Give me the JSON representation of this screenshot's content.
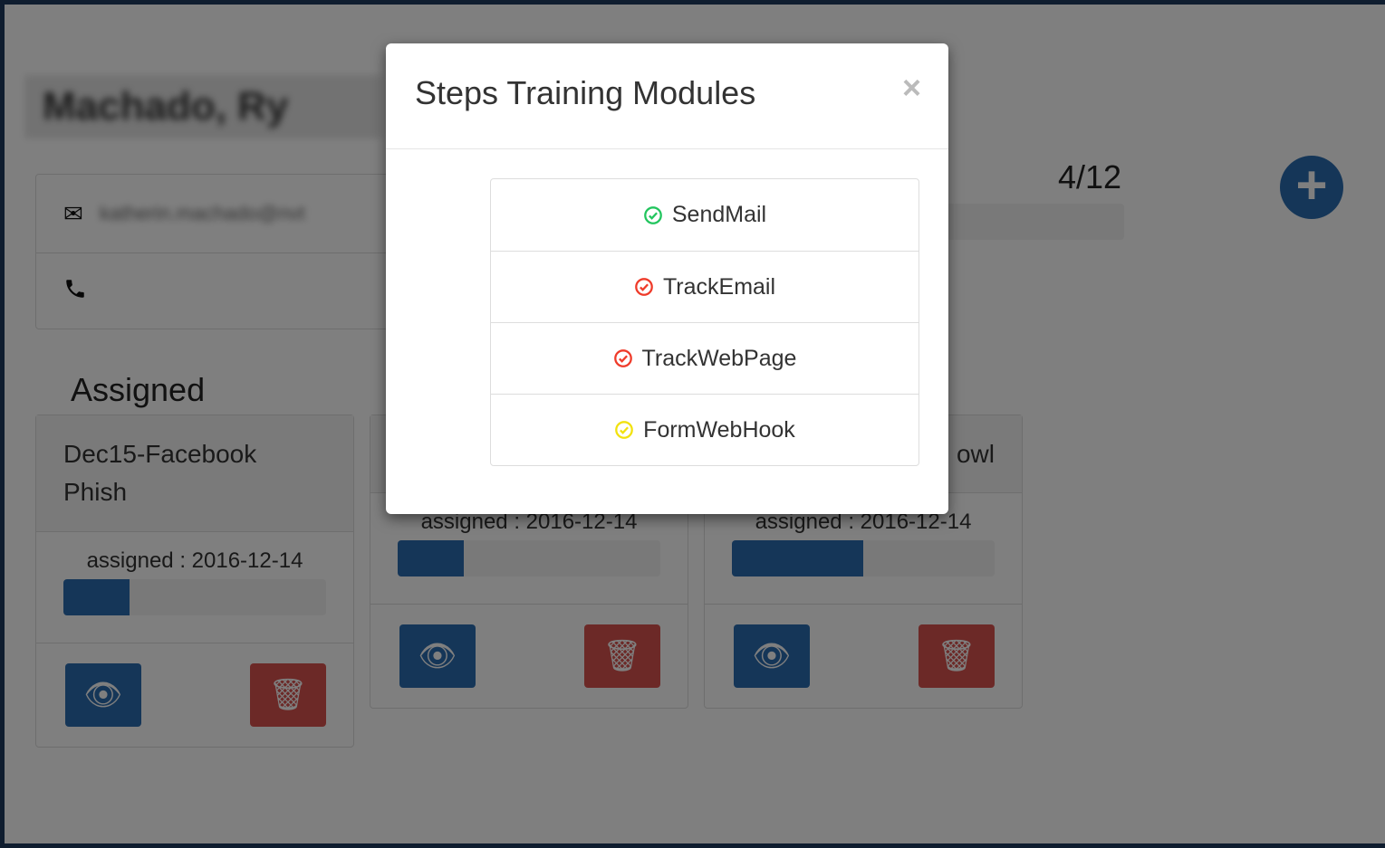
{
  "page": {
    "user_name": "Machado, Ry",
    "email": "katherin.machado@nvt",
    "progress_count": "4/12",
    "section_title": "Assigned"
  },
  "icons": {
    "email": "envelope-icon",
    "phone": "phone-icon",
    "add": "plus-circle-icon",
    "view": "eye-icon",
    "delete": "trash-icon",
    "check": "check-circle-icon"
  },
  "cards": [
    {
      "title": "Dec15-Facebook Phish",
      "assigned": "assigned : 2016-12-14",
      "progress": 0.25
    },
    {
      "title": "",
      "assigned": "assigned : 2016-12-14",
      "progress": 0.25
    },
    {
      "title": "owl",
      "assigned": "assigned : 2016-12-14",
      "progress": 0.5
    }
  ],
  "modal": {
    "title": "Steps Training Modules",
    "close_label": "×",
    "modules": [
      {
        "label": "SendMail",
        "status_color": "#22c55e"
      },
      {
        "label": "TrackEmail",
        "status_color": "#ef3b2a"
      },
      {
        "label": "TrackWebPage",
        "status_color": "#ef3b2a"
      },
      {
        "label": "FormWebHook",
        "status_color": "#f2e20f"
      }
    ]
  },
  "colors": {
    "primary": "#2b6cb0",
    "danger": "#d9534f",
    "frame": "#1f3a5f"
  }
}
